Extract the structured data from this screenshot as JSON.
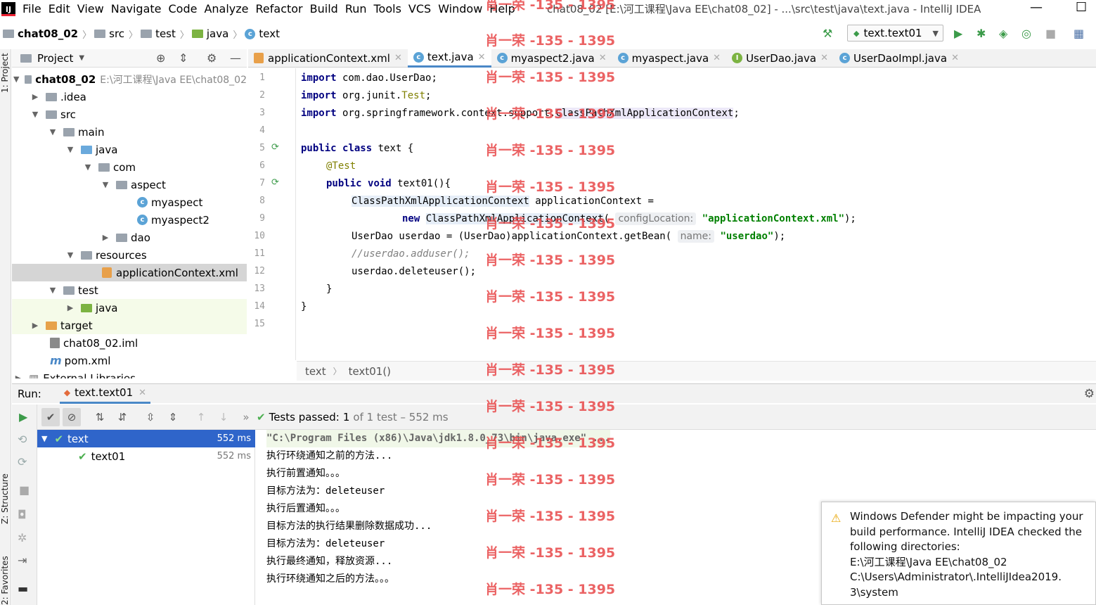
{
  "menu": {
    "items": [
      "File",
      "Edit",
      "View",
      "Navigate",
      "Code",
      "Analyze",
      "Refactor",
      "Build",
      "Run",
      "Tools",
      "VCS",
      "Window",
      "Help"
    ],
    "window_title": "chat08_02 [E:\\河工课程\\Java EE\\chat08_02] - ...\\src\\test\\java\\text.java - IntelliJ IDEA"
  },
  "breadcrumb": {
    "project": "chat08_02",
    "src": "src",
    "test": "test",
    "java": "java",
    "file": "text"
  },
  "run_config": {
    "label": "text.text01"
  },
  "left_strip": {
    "project": "1: Project",
    "structure": "Z: Structure",
    "favorites": "2: Favorites"
  },
  "project_panel": {
    "title": "Project",
    "root": {
      "name": "chat08_02",
      "path": "E:\\河工课程\\Java EE\\chat08_02"
    },
    "items": [
      {
        "label": ".idea"
      },
      {
        "label": "src"
      },
      {
        "label": "main"
      },
      {
        "label": "java"
      },
      {
        "label": "com"
      },
      {
        "label": "aspect"
      },
      {
        "label": "myaspect"
      },
      {
        "label": "myaspect2"
      },
      {
        "label": "dao"
      },
      {
        "label": "resources"
      },
      {
        "label": "applicationContext.xml"
      },
      {
        "label": "test"
      },
      {
        "label": "java"
      },
      {
        "label": "target"
      },
      {
        "label": "chat08_02.iml"
      },
      {
        "label": "pom.xml"
      },
      {
        "label": "External Libraries"
      }
    ]
  },
  "editor_tabs": [
    {
      "label": "applicationContext.xml"
    },
    {
      "label": "text.java"
    },
    {
      "label": "myaspect2.java"
    },
    {
      "label": "myaspect.java"
    },
    {
      "label": "UserDao.java"
    },
    {
      "label": "UserDaoImpl.java"
    }
  ],
  "code": {
    "line_numbers": [
      "1",
      "2",
      "3",
      "4",
      "5",
      "6",
      "7",
      "8",
      "9",
      "10",
      "11",
      "12",
      "13",
      "14",
      "15"
    ],
    "l1_kw": "import",
    "l1_rest": " com.dao.UserDao;",
    "l2_kw": "import",
    "l2_a": " org.junit.",
    "l2_b": "Test",
    "l2_c": ";",
    "l3_kw": "import",
    "l3_a": " org.springframework.context.support.",
    "l3_b": "ClassPathXmlApplicationContext",
    "l3_c": ";",
    "l5_kw1": "public",
    "l5_kw2": "class",
    "l5_rest": " text {",
    "l6": "@Test",
    "l7_kw1": "public",
    "l7_kw2": "void",
    "l7_rest": " text01(){",
    "l8_a": "ClassPathXmlApplicationContext",
    "l8_b": " applicationContext =",
    "l9_kw": "new",
    "l9_a": "ClassPathXmlApplicationContext",
    "l9_paren": "(",
    "l9_hint": "configLocation:",
    "l9_str": "\"applicationContext.xml\"",
    "l9_end": ");",
    "l10_a": "UserDao userdao = (UserDao)applicationContext.getBean(",
    "l10_hint": "name:",
    "l10_str": "\"userdao\"",
    "l10_end": ");",
    "l11": "//userdao.adduser();",
    "l12": "userdao.deleteuser();",
    "l13": "}",
    "l14": "}"
  },
  "editor_breadcrumb": {
    "a": "text",
    "b": "text01()"
  },
  "run_panel": {
    "label": "Run:",
    "tab": "text.text01",
    "status_prefix": "Tests passed:",
    "status_count": "1",
    "status_suffix": "of 1 test – 552 ms",
    "tests": [
      {
        "name": "text",
        "time": "552 ms"
      },
      {
        "name": "text01",
        "time": "552 ms"
      }
    ],
    "output": [
      "\"C:\\Program Files (x86)\\Java\\jdk1.8.0_73\\bin\\java.exe\" ...",
      "执行环绕通知之前的方法...",
      "执行前置通知。。。",
      "目标方法为：deleteuser",
      "执行后置通知。。。",
      "目标方法的执行结果删除数据成功...",
      "目标方法为：deleteuser",
      "执行最终通知，释放资源...",
      "执行环绕通知之后的方法。。。"
    ]
  },
  "notification": {
    "lines": [
      "Windows Defender might be impacting your",
      "build performance. IntelliJ IDEA checked the",
      "following directories:",
      "E:\\河工课程\\Java EE\\chat08_02",
      "C:\\Users\\Administrator\\.IntelliJIdea2019.",
      "3\\system"
    ]
  },
  "watermark": {
    "text": "肖一荣 -135 - 1395"
  },
  "colors": {
    "accent": "#2f65ca",
    "pass": "#4caf50",
    "keyword": "#000080",
    "string": "#008000",
    "watermark": "#e8484a"
  }
}
